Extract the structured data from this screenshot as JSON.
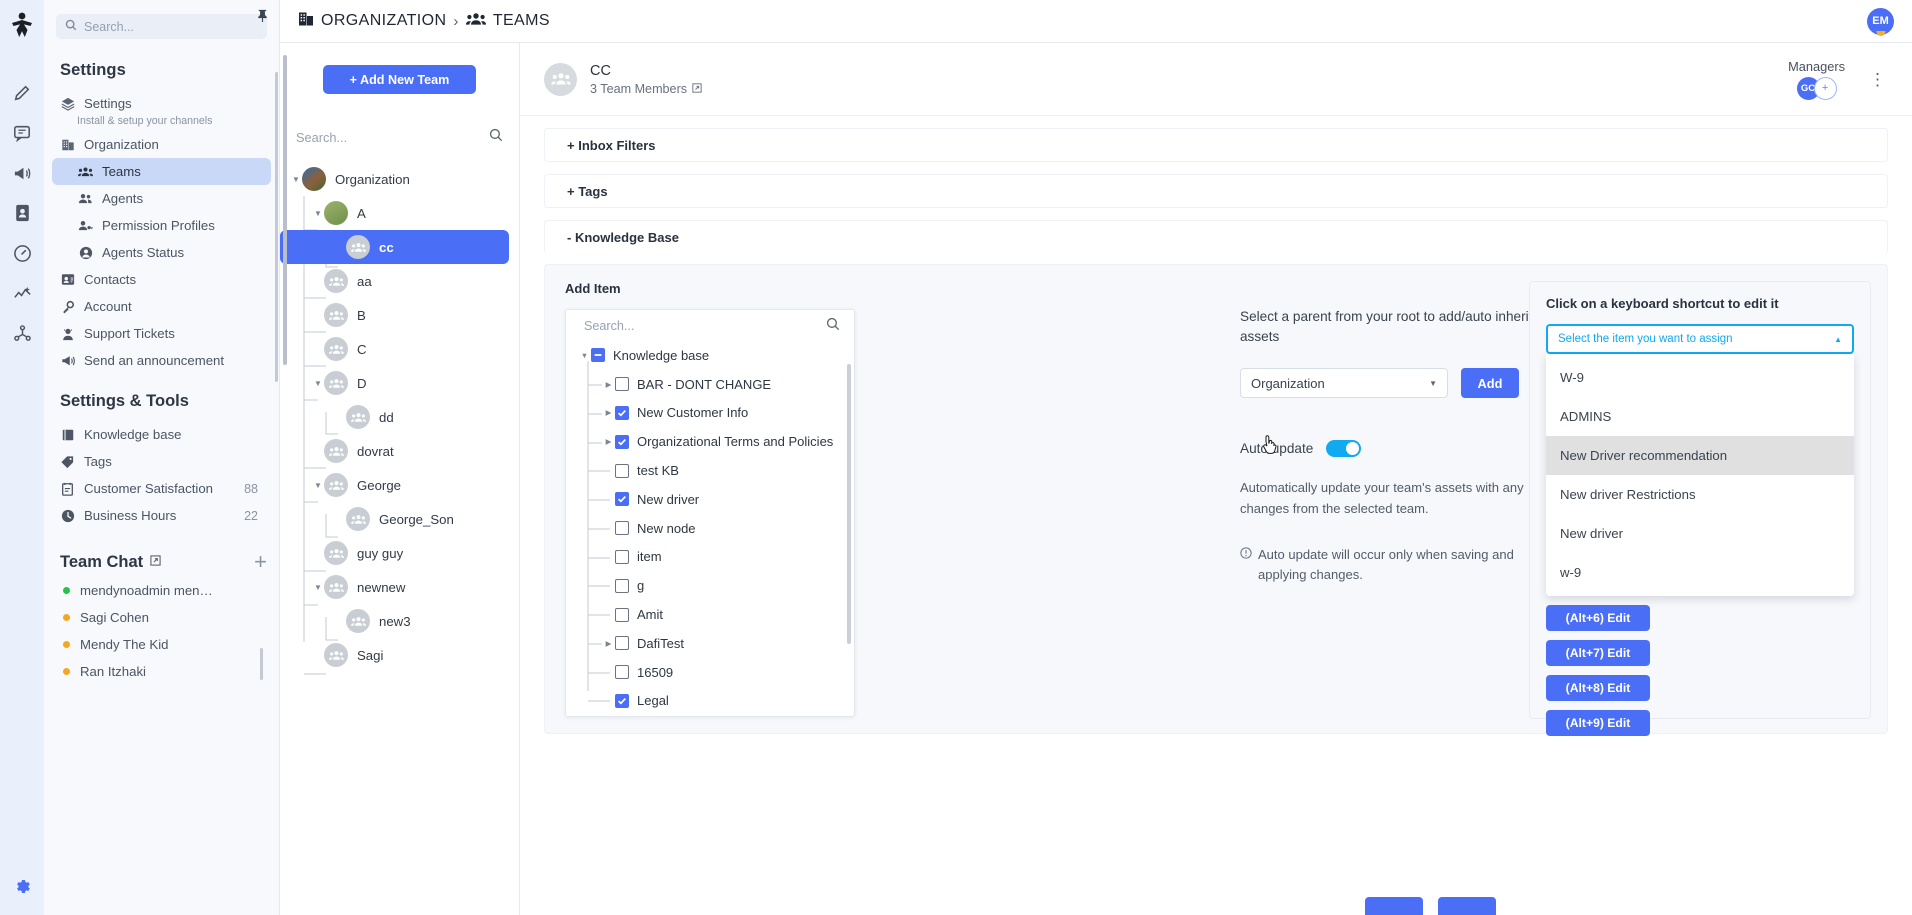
{
  "rail": {
    "logo_icon": "app-logo-icon",
    "items": [
      {
        "icon": "pencil-icon"
      },
      {
        "icon": "chat-bubble-icon"
      },
      {
        "icon": "megaphone-icon"
      },
      {
        "icon": "contact-card-icon"
      },
      {
        "icon": "gauge-icon"
      },
      {
        "icon": "analytics-icon"
      },
      {
        "icon": "integrations-icon"
      }
    ],
    "gear_icon": "gear-icon"
  },
  "sidebar": {
    "pin_icon": "pin-icon",
    "search_placeholder": "Search...",
    "search_icon": "search-icon",
    "heading": "Settings",
    "items": [
      {
        "label": "Settings",
        "icon": "layers-icon",
        "desc": "Install & setup your channels",
        "active": false,
        "sub": false
      },
      {
        "label": "Organization",
        "icon": "building-icon",
        "active": false,
        "sub": false
      },
      {
        "label": "Teams",
        "icon": "teams-icon",
        "active": true,
        "sub": true
      },
      {
        "label": "Agents",
        "icon": "agents-icon",
        "active": false,
        "sub": true
      },
      {
        "label": "Permission Profiles",
        "icon": "permission-icon",
        "active": false,
        "sub": true
      },
      {
        "label": "Agents Status",
        "icon": "agent-status-icon",
        "active": false,
        "sub": true
      },
      {
        "label": "Contacts",
        "icon": "contacts-icon",
        "active": false,
        "sub": false
      },
      {
        "label": "Account",
        "icon": "key-icon",
        "active": false,
        "sub": false
      },
      {
        "label": "Support Tickets",
        "icon": "support-icon",
        "active": false,
        "sub": false
      },
      {
        "label": "Send an announcement",
        "icon": "announcement-icon",
        "active": false,
        "sub": false
      }
    ],
    "tools_heading": "Settings & Tools",
    "tools": [
      {
        "label": "Knowledge base",
        "icon": "book-icon",
        "count": ""
      },
      {
        "label": "Tags",
        "icon": "tag-icon",
        "count": ""
      },
      {
        "label": "Customer Satisfaction",
        "icon": "survey-icon",
        "count": "88"
      },
      {
        "label": "Business Hours",
        "icon": "clock-icon",
        "count": "22"
      }
    ],
    "team_chat": {
      "heading": "Team Chat",
      "external_icon": "external-link-icon",
      "add_icon": "plus-icon",
      "members": [
        {
          "name": "mendynoadmin men…",
          "status_color": "#27c24c"
        },
        {
          "name": "Sagi Cohen",
          "status_color": "#f5a623"
        },
        {
          "name": "Mendy The Kid",
          "status_color": "#f5a623"
        },
        {
          "name": "Ran Itzhaki",
          "status_color": "#f5a623"
        }
      ]
    }
  },
  "topbar": {
    "breadcrumb_icon": "building-icon",
    "breadcrumb_root": "ORGANIZATION",
    "separator": "›",
    "breadcrumb_section_icon": "teams-icon",
    "breadcrumb_section": "TEAMS",
    "user_initials": "EM"
  },
  "team_panel": {
    "add_button": "+ Add New Team",
    "search_placeholder": "Search...",
    "search_icon": "search-icon",
    "nodes": [
      {
        "label": "Organization",
        "depth": 0,
        "caret": "down",
        "selected": false,
        "avatar": "org-photo"
      },
      {
        "label": "A",
        "depth": 1,
        "caret": "down",
        "selected": false,
        "avatar": "robot-photo"
      },
      {
        "label": "cc",
        "depth": 2,
        "caret": "none",
        "selected": true,
        "avatar": "team-icon"
      },
      {
        "label": "aa",
        "depth": 1,
        "caret": "none",
        "selected": false,
        "avatar": "team-icon"
      },
      {
        "label": "B",
        "depth": 1,
        "caret": "none",
        "selected": false,
        "avatar": "team-icon"
      },
      {
        "label": "C",
        "depth": 1,
        "caret": "none",
        "selected": false,
        "avatar": "team-icon"
      },
      {
        "label": "D",
        "depth": 1,
        "caret": "down",
        "selected": false,
        "avatar": "team-icon"
      },
      {
        "label": "dd",
        "depth": 2,
        "caret": "none",
        "selected": false,
        "avatar": "team-icon"
      },
      {
        "label": "dovrat",
        "depth": 1,
        "caret": "none",
        "selected": false,
        "avatar": "team-icon"
      },
      {
        "label": "George",
        "depth": 1,
        "caret": "down",
        "selected": false,
        "avatar": "team-icon"
      },
      {
        "label": "George_Son",
        "depth": 2,
        "caret": "none",
        "selected": false,
        "avatar": "team-icon"
      },
      {
        "label": "guy guy",
        "depth": 1,
        "caret": "none",
        "selected": false,
        "avatar": "team-icon"
      },
      {
        "label": "newnew",
        "depth": 1,
        "caret": "down",
        "selected": false,
        "avatar": "team-icon"
      },
      {
        "label": "new3",
        "depth": 2,
        "caret": "none",
        "selected": false,
        "avatar": "team-icon"
      },
      {
        "label": "Sagi",
        "depth": 1,
        "caret": "none",
        "selected": false,
        "avatar": "team-icon"
      }
    ]
  },
  "team_header": {
    "avatar_icon": "team-icon",
    "name": "CC",
    "members_text": "3 Team Members",
    "members_edit_icon": "external-link-icon",
    "managers_label": "Managers",
    "manager_initials": "GC",
    "manager_add": "+",
    "kebab_icon": "kebab-menu-icon"
  },
  "accordions": [
    {
      "label": "+ Inbox Filters",
      "open": false
    },
    {
      "label": "+ Tags",
      "open": false
    },
    {
      "label": "- Knowledge Base",
      "open": true
    }
  ],
  "knowledge_base": {
    "add_item_title": "Add Item",
    "search_placeholder": "Search...",
    "search_icon": "search-icon",
    "tree": [
      {
        "label": "Knowledge base",
        "depth": 0,
        "caret": "down",
        "check": "indeterminate"
      },
      {
        "label": "BAR - DONT CHANGE",
        "depth": 1,
        "caret": "right",
        "check": "unchecked"
      },
      {
        "label": "New Customer Info",
        "depth": 1,
        "caret": "right",
        "check": "checked"
      },
      {
        "label": "Organizational Terms and Policies",
        "depth": 1,
        "caret": "right",
        "check": "checked"
      },
      {
        "label": "test KB",
        "depth": 1,
        "caret": "none",
        "check": "unchecked"
      },
      {
        "label": "New driver",
        "depth": 1,
        "caret": "none",
        "check": "checked"
      },
      {
        "label": "New node",
        "depth": 1,
        "caret": "none",
        "check": "unchecked"
      },
      {
        "label": "item",
        "depth": 1,
        "caret": "none",
        "check": "unchecked"
      },
      {
        "label": "g",
        "depth": 1,
        "caret": "none",
        "check": "unchecked"
      },
      {
        "label": "Amit",
        "depth": 1,
        "caret": "none",
        "check": "unchecked"
      },
      {
        "label": "DafiTest",
        "depth": 1,
        "caret": "right",
        "check": "unchecked"
      },
      {
        "label": "16509",
        "depth": 1,
        "caret": "none",
        "check": "unchecked"
      },
      {
        "label": "Legal",
        "depth": 1,
        "caret": "none",
        "check": "checked"
      }
    ],
    "parent_hint": "Select a parent from your root to add/auto inherit assets",
    "parent_value": "Organization",
    "parent_caret_icon": "chevron-down-icon",
    "add_button": "Add",
    "auto_update_label": "Auto update",
    "auto_update_on": true,
    "auto_update_desc": "Automatically update your team's assets with any changes from the selected team.",
    "auto_update_note_icon": "info-icon",
    "auto_update_note": "Auto update will occur only when saving and applying changes."
  },
  "shortcuts_panel": {
    "title": "Click on a keyboard shortcut to edit it",
    "select_placeholder": "Select the item you want to assign",
    "select_caret_icon": "chevron-up-icon",
    "options": [
      {
        "label": "W-9",
        "hover": false
      },
      {
        "label": "ADMINS",
        "hover": false
      },
      {
        "label": "New Driver recommendation",
        "hover": true
      },
      {
        "label": "New driver Restrictions",
        "hover": false
      },
      {
        "label": "New driver",
        "hover": false
      },
      {
        "label": "w-9",
        "hover": false
      }
    ],
    "edit_buttons": [
      {
        "label": "(Alt+6) Edit"
      },
      {
        "label": "(Alt+7) Edit"
      },
      {
        "label": "(Alt+8) Edit"
      },
      {
        "label": "(Alt+9) Edit"
      }
    ],
    "cursor_icon": "hand-pointer-cursor"
  },
  "colors": {
    "brand_blue": "#4a6ef5",
    "accent_cyan": "#11a9f0",
    "sidebar_bg": "#f7f9fc",
    "rail_bg": "#e9f0fb",
    "selected_nav": "#c9d8f7"
  }
}
